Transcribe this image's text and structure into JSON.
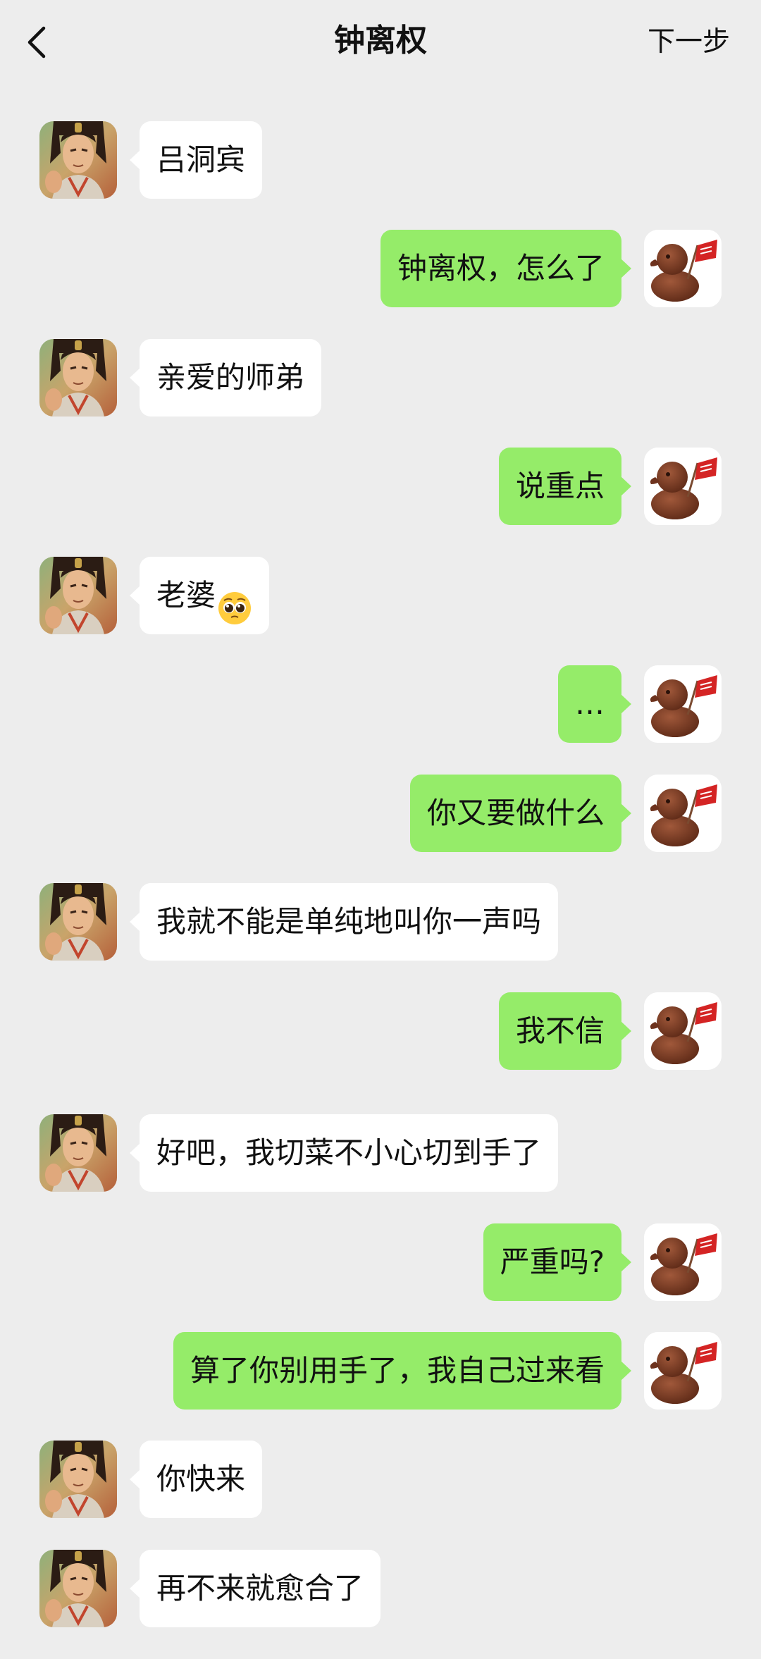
{
  "header": {
    "title": "钟离权",
    "next_label": "下一步",
    "back_icon": "chevron-left-icon"
  },
  "avatars": {
    "left": "zhongliquan-avatar",
    "right": "chocolate-duck-avatar"
  },
  "colors": {
    "background": "#ededed",
    "bubble_self": "#95ec69",
    "bubble_other": "#ffffff"
  },
  "messages": [
    {
      "side": "left",
      "text": "吕洞宾"
    },
    {
      "side": "right",
      "text": "钟离权，怎么了"
    },
    {
      "side": "left",
      "text": "亲爱的师弟"
    },
    {
      "side": "right",
      "text": "说重点"
    },
    {
      "side": "left",
      "text": "老婆",
      "emoji": "pleading-face"
    },
    {
      "side": "right",
      "text": "…"
    },
    {
      "side": "right",
      "text": "你又要做什么"
    },
    {
      "side": "left",
      "text": "我就不能是单纯地叫你一声吗"
    },
    {
      "side": "right",
      "text": "我不信"
    },
    {
      "side": "left",
      "text": "好吧，我切菜不小心切到手了"
    },
    {
      "side": "right",
      "text": "严重吗?"
    },
    {
      "side": "right",
      "text": "算了你别用手了，我自己过来看"
    },
    {
      "side": "left",
      "text": "你快来"
    },
    {
      "side": "left",
      "text": "再不来就愈合了"
    }
  ]
}
